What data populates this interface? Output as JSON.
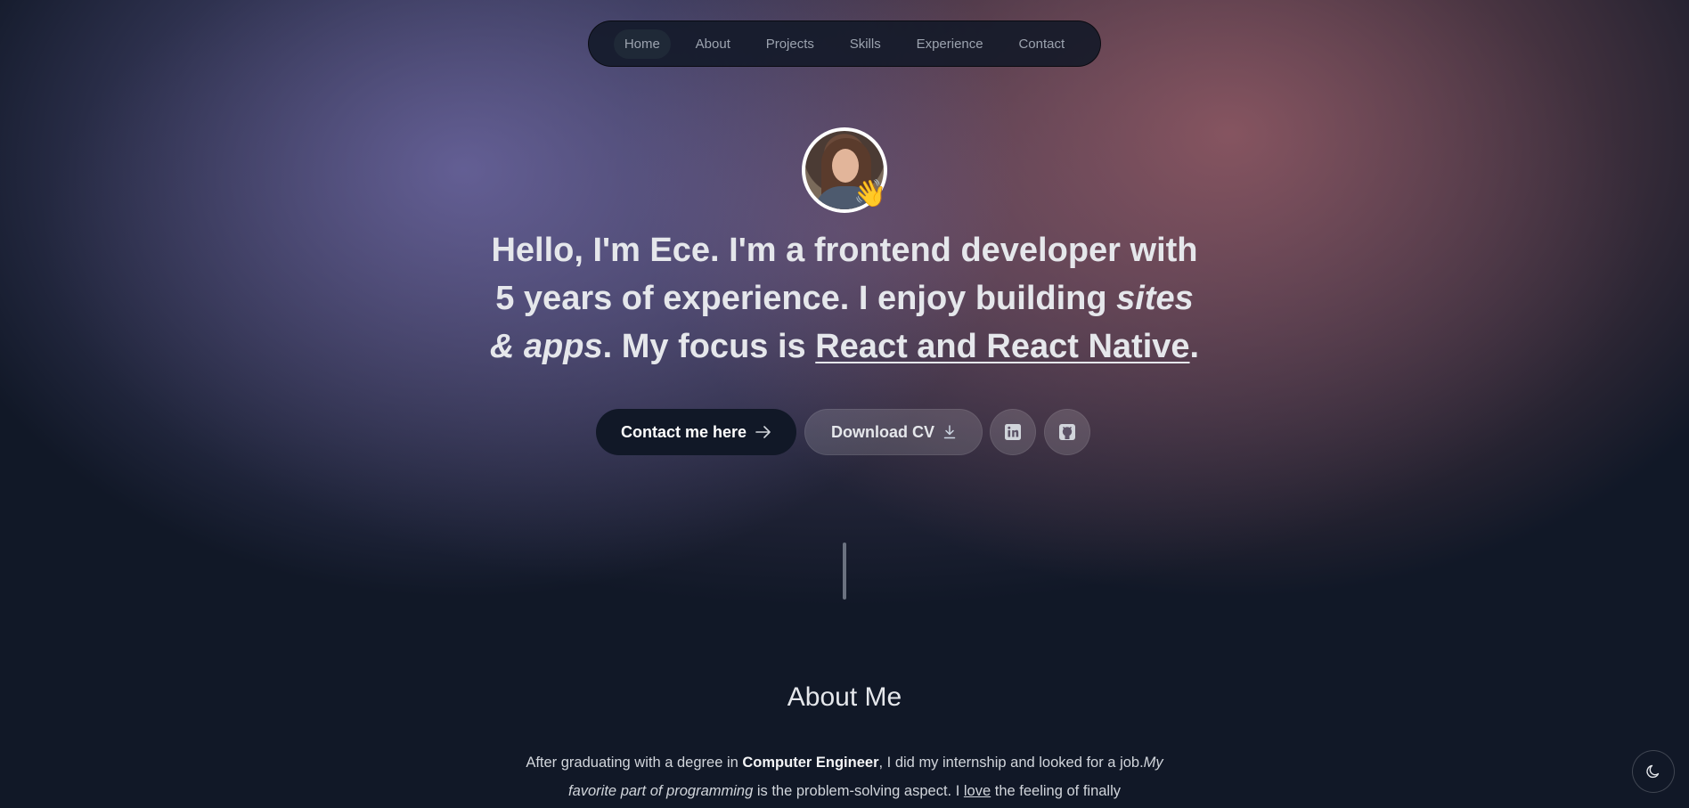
{
  "nav": {
    "items": [
      {
        "label": "Home",
        "active": true
      },
      {
        "label": "About"
      },
      {
        "label": "Projects"
      },
      {
        "label": "Skills"
      },
      {
        "label": "Experience"
      },
      {
        "label": "Contact"
      }
    ]
  },
  "hero": {
    "wave_emoji": "👋",
    "headline": {
      "p1": "Hello, I'm Ece.",
      "p2": " I'm a ",
      "p3": "frontend developer",
      "p4": " with ",
      "p5": "5 years",
      "p6": " of experience. I enjoy building ",
      "p7": "sites & apps",
      "p8": ". My focus is ",
      "p9": "React and React Native",
      "p10": "."
    },
    "contact_label": "Contact me here",
    "cv_label": "Download CV",
    "icons": {
      "contact_arrow": "arrow-right-icon",
      "cv_download": "download-icon",
      "linkedin": "linkedin-icon",
      "github": "github-icon"
    }
  },
  "about": {
    "title": "About Me",
    "t1": "After graduating with a degree in ",
    "t2": "Computer Engineer",
    "t3": ", I did my internship and looked for a job.",
    "t4": "My favorite part of programming",
    "t5": " is the problem-solving aspect. I ",
    "t6": "love",
    "t7": " the feeling of finally"
  },
  "theme_toggle": {
    "icon": "moon-icon"
  },
  "colors": {
    "background": "#111827",
    "nav_bg": "#111827",
    "button_dark": "#111827",
    "text": "#e5e7eb"
  }
}
